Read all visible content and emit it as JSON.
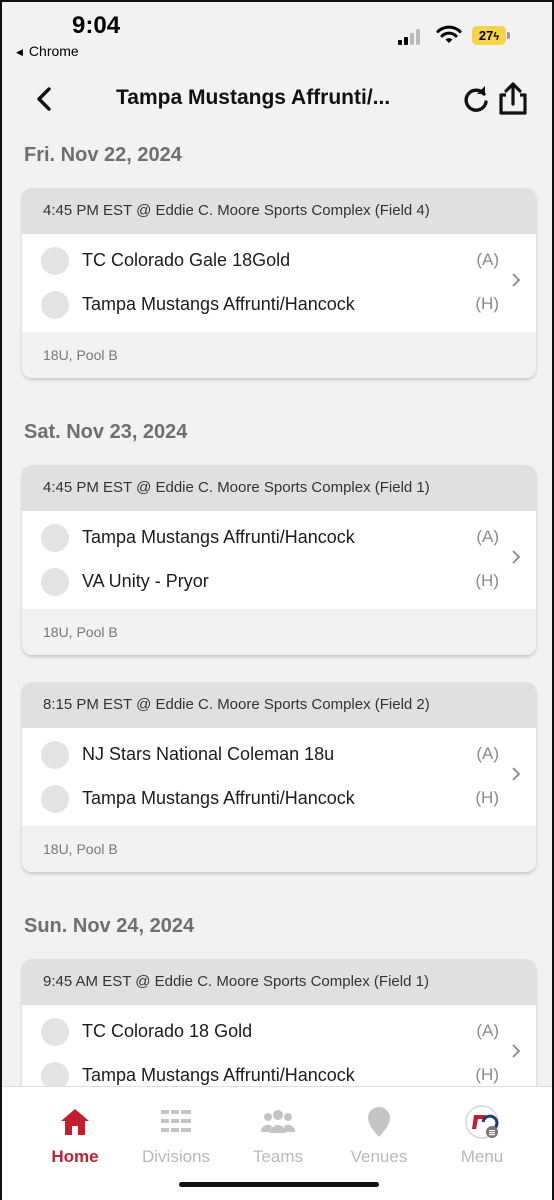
{
  "status": {
    "time": "9:04",
    "back_app": "Chrome",
    "battery": "27"
  },
  "header": {
    "title": "Tampa Mustangs Affrunti/..."
  },
  "days": [
    {
      "date": "Fri. Nov 22, 2024",
      "games": [
        {
          "header": "4:45 PM EST @ Eddie C. Moore Sports Complex  (Field 4)",
          "teams": [
            {
              "name": "TC Colorado Gale 18Gold",
              "side": "(A)"
            },
            {
              "name": "Tampa Mustangs Affrunti/Hancock",
              "side": "(H)"
            }
          ],
          "footer": "18U, Pool B"
        }
      ]
    },
    {
      "date": "Sat. Nov 23, 2024",
      "games": [
        {
          "header": "4:45 PM EST @ Eddie C. Moore Sports Complex  (Field 1)",
          "teams": [
            {
              "name": "Tampa Mustangs Affrunti/Hancock",
              "side": "(A)"
            },
            {
              "name": "VA Unity - Pryor",
              "side": "(H)"
            }
          ],
          "footer": "18U, Pool B"
        },
        {
          "header": "8:15 PM EST @ Eddie C. Moore Sports Complex  (Field 2)",
          "teams": [
            {
              "name": "NJ Stars National Coleman 18u",
              "side": "(A)"
            },
            {
              "name": "Tampa Mustangs Affrunti/Hancock",
              "side": "(H)"
            }
          ],
          "footer": "18U, Pool B"
        }
      ]
    },
    {
      "date": "Sun. Nov 24, 2024",
      "games": [
        {
          "header": "9:45 AM EST @ Eddie C. Moore Sports Complex  (Field 1)",
          "teams": [
            {
              "name": "TC Colorado 18 Gold",
              "side": "(A)"
            },
            {
              "name": "Tampa Mustangs Affrunti/Hancock",
              "side": "(H)"
            }
          ],
          "footer": ""
        }
      ]
    }
  ],
  "tabs": [
    {
      "label": "Home",
      "icon": "home-icon",
      "active": true
    },
    {
      "label": "Divisions",
      "icon": "divisions-icon",
      "active": false
    },
    {
      "label": "Teams",
      "icon": "teams-icon",
      "active": false
    },
    {
      "label": "Venues",
      "icon": "location-pin-icon",
      "active": false
    },
    {
      "label": "Menu",
      "icon": "app-logo-icon",
      "active": false
    }
  ],
  "colors": {
    "accent": "#c0202e",
    "card_header": "#e0e0e0",
    "background": "#f2f2f2",
    "battery": "#f5d24a"
  }
}
